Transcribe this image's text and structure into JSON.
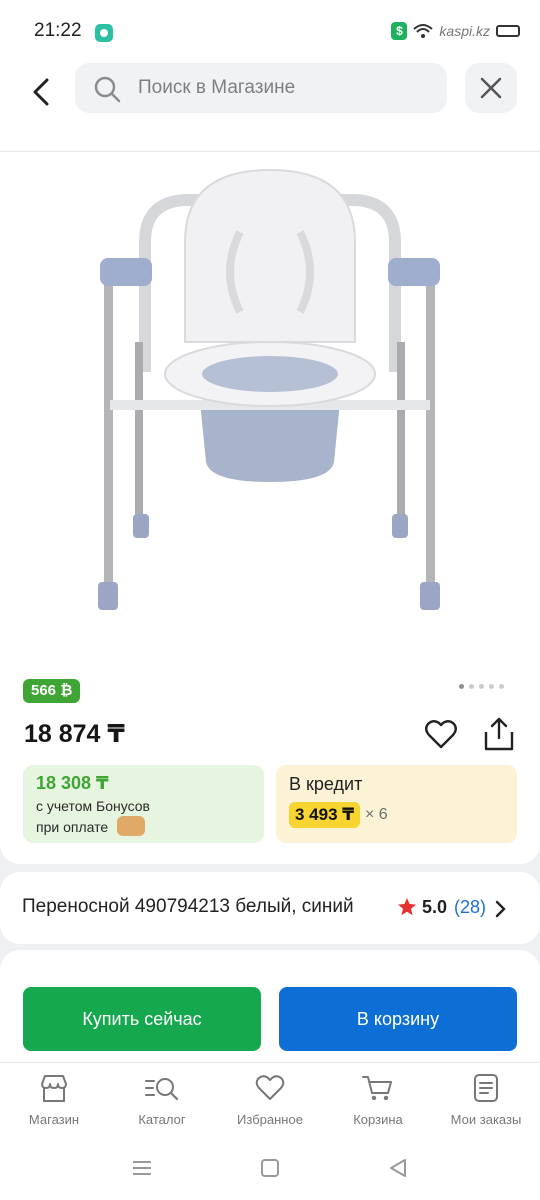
{
  "status_bar": {
    "time": "21:22",
    "watermark": "kaspi.kz"
  },
  "header": {
    "search_placeholder": "Поиск в Магазине"
  },
  "product": {
    "bonus_badge": "566 ₿",
    "price": "18 874 ₸",
    "bonus_offer": {
      "amount": "18 308 ₸",
      "line1": "с учетом Бонусов",
      "line2": "при оплате"
    },
    "credit_offer": {
      "title": "В кредит",
      "monthly": "3 493 ₸",
      "months": "× 6"
    },
    "title": "Переносной 490794213 белый, синий",
    "rating": "5.0",
    "reviews": "(28)"
  },
  "actions": {
    "buy_now": "Купить сейчас",
    "add_to_cart": "В корзину"
  },
  "bottom_nav": [
    {
      "label": "Магазин",
      "icon": "shop-icon"
    },
    {
      "label": "Каталог",
      "icon": "catalog-search-icon"
    },
    {
      "label": "Избранное",
      "icon": "heart-icon"
    },
    {
      "label": "Корзина",
      "icon": "cart-icon"
    },
    {
      "label": "Мои заказы",
      "icon": "orders-icon"
    }
  ],
  "colors": {
    "green": "#16a84f",
    "blue": "#0d6fd6",
    "bonus_green": "#3fa535",
    "credit_yellow": "#f7d430"
  }
}
